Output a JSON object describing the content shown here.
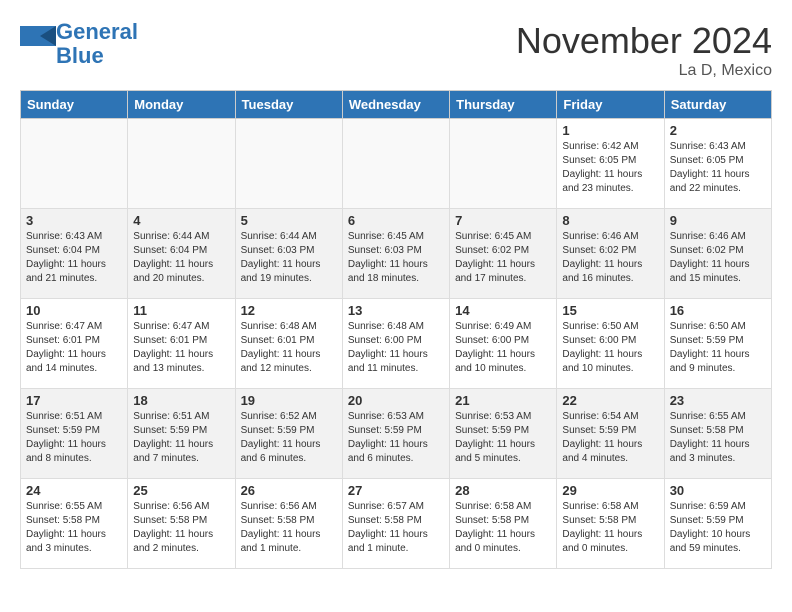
{
  "logo": {
    "line1": "General",
    "line2": "Blue"
  },
  "title": "November 2024",
  "location": "La D, Mexico",
  "days_of_week": [
    "Sunday",
    "Monday",
    "Tuesday",
    "Wednesday",
    "Thursday",
    "Friday",
    "Saturday"
  ],
  "weeks": [
    [
      {
        "day": "",
        "info": "",
        "empty": true
      },
      {
        "day": "",
        "info": "",
        "empty": true
      },
      {
        "day": "",
        "info": "",
        "empty": true
      },
      {
        "day": "",
        "info": "",
        "empty": true
      },
      {
        "day": "",
        "info": "",
        "empty": true
      },
      {
        "day": "1",
        "info": "Sunrise: 6:42 AM\nSunset: 6:05 PM\nDaylight: 11 hours\nand 23 minutes.",
        "empty": false
      },
      {
        "day": "2",
        "info": "Sunrise: 6:43 AM\nSunset: 6:05 PM\nDaylight: 11 hours\nand 22 minutes.",
        "empty": false
      }
    ],
    [
      {
        "day": "3",
        "info": "Sunrise: 6:43 AM\nSunset: 6:04 PM\nDaylight: 11 hours\nand 21 minutes.",
        "empty": false
      },
      {
        "day": "4",
        "info": "Sunrise: 6:44 AM\nSunset: 6:04 PM\nDaylight: 11 hours\nand 20 minutes.",
        "empty": false
      },
      {
        "day": "5",
        "info": "Sunrise: 6:44 AM\nSunset: 6:03 PM\nDaylight: 11 hours\nand 19 minutes.",
        "empty": false
      },
      {
        "day": "6",
        "info": "Sunrise: 6:45 AM\nSunset: 6:03 PM\nDaylight: 11 hours\nand 18 minutes.",
        "empty": false
      },
      {
        "day": "7",
        "info": "Sunrise: 6:45 AM\nSunset: 6:02 PM\nDaylight: 11 hours\nand 17 minutes.",
        "empty": false
      },
      {
        "day": "8",
        "info": "Sunrise: 6:46 AM\nSunset: 6:02 PM\nDaylight: 11 hours\nand 16 minutes.",
        "empty": false
      },
      {
        "day": "9",
        "info": "Sunrise: 6:46 AM\nSunset: 6:02 PM\nDaylight: 11 hours\nand 15 minutes.",
        "empty": false
      }
    ],
    [
      {
        "day": "10",
        "info": "Sunrise: 6:47 AM\nSunset: 6:01 PM\nDaylight: 11 hours\nand 14 minutes.",
        "empty": false
      },
      {
        "day": "11",
        "info": "Sunrise: 6:47 AM\nSunset: 6:01 PM\nDaylight: 11 hours\nand 13 minutes.",
        "empty": false
      },
      {
        "day": "12",
        "info": "Sunrise: 6:48 AM\nSunset: 6:01 PM\nDaylight: 11 hours\nand 12 minutes.",
        "empty": false
      },
      {
        "day": "13",
        "info": "Sunrise: 6:48 AM\nSunset: 6:00 PM\nDaylight: 11 hours\nand 11 minutes.",
        "empty": false
      },
      {
        "day": "14",
        "info": "Sunrise: 6:49 AM\nSunset: 6:00 PM\nDaylight: 11 hours\nand 10 minutes.",
        "empty": false
      },
      {
        "day": "15",
        "info": "Sunrise: 6:50 AM\nSunset: 6:00 PM\nDaylight: 11 hours\nand 10 minutes.",
        "empty": false
      },
      {
        "day": "16",
        "info": "Sunrise: 6:50 AM\nSunset: 5:59 PM\nDaylight: 11 hours\nand 9 minutes.",
        "empty": false
      }
    ],
    [
      {
        "day": "17",
        "info": "Sunrise: 6:51 AM\nSunset: 5:59 PM\nDaylight: 11 hours\nand 8 minutes.",
        "empty": false
      },
      {
        "day": "18",
        "info": "Sunrise: 6:51 AM\nSunset: 5:59 PM\nDaylight: 11 hours\nand 7 minutes.",
        "empty": false
      },
      {
        "day": "19",
        "info": "Sunrise: 6:52 AM\nSunset: 5:59 PM\nDaylight: 11 hours\nand 6 minutes.",
        "empty": false
      },
      {
        "day": "20",
        "info": "Sunrise: 6:53 AM\nSunset: 5:59 PM\nDaylight: 11 hours\nand 6 minutes.",
        "empty": false
      },
      {
        "day": "21",
        "info": "Sunrise: 6:53 AM\nSunset: 5:59 PM\nDaylight: 11 hours\nand 5 minutes.",
        "empty": false
      },
      {
        "day": "22",
        "info": "Sunrise: 6:54 AM\nSunset: 5:59 PM\nDaylight: 11 hours\nand 4 minutes.",
        "empty": false
      },
      {
        "day": "23",
        "info": "Sunrise: 6:55 AM\nSunset: 5:58 PM\nDaylight: 11 hours\nand 3 minutes.",
        "empty": false
      }
    ],
    [
      {
        "day": "24",
        "info": "Sunrise: 6:55 AM\nSunset: 5:58 PM\nDaylight: 11 hours\nand 3 minutes.",
        "empty": false
      },
      {
        "day": "25",
        "info": "Sunrise: 6:56 AM\nSunset: 5:58 PM\nDaylight: 11 hours\nand 2 minutes.",
        "empty": false
      },
      {
        "day": "26",
        "info": "Sunrise: 6:56 AM\nSunset: 5:58 PM\nDaylight: 11 hours\nand 1 minute.",
        "empty": false
      },
      {
        "day": "27",
        "info": "Sunrise: 6:57 AM\nSunset: 5:58 PM\nDaylight: 11 hours\nand 1 minute.",
        "empty": false
      },
      {
        "day": "28",
        "info": "Sunrise: 6:58 AM\nSunset: 5:58 PM\nDaylight: 11 hours\nand 0 minutes.",
        "empty": false
      },
      {
        "day": "29",
        "info": "Sunrise: 6:58 AM\nSunset: 5:58 PM\nDaylight: 11 hours\nand 0 minutes.",
        "empty": false
      },
      {
        "day": "30",
        "info": "Sunrise: 6:59 AM\nSunset: 5:59 PM\nDaylight: 10 hours\nand 59 minutes.",
        "empty": false
      }
    ]
  ]
}
